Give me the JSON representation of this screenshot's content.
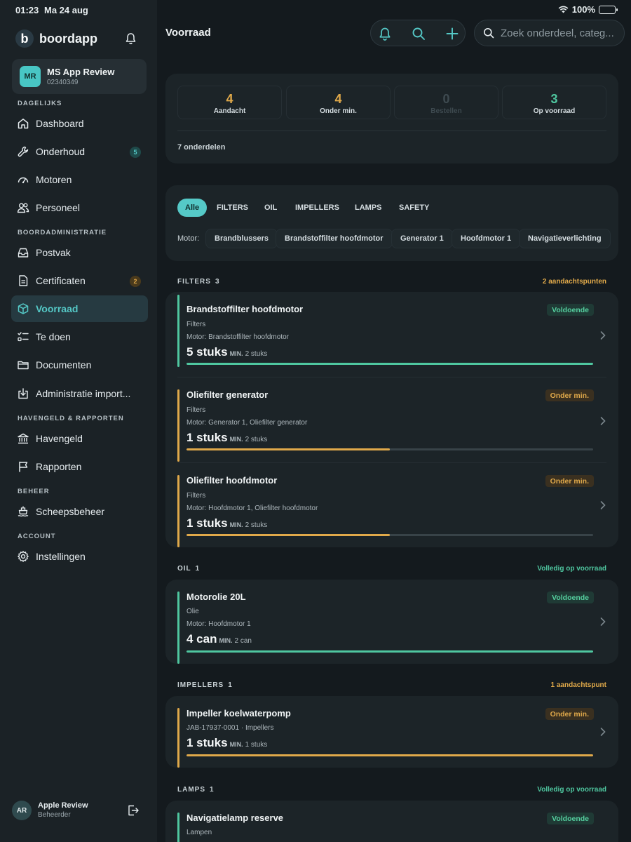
{
  "status_bar": {
    "time": "01:23",
    "date": "Ma 24 aug",
    "battery": "100%"
  },
  "sidebar": {
    "brand": "boordapp",
    "brand_logo_letter": "b",
    "account": {
      "initials": "MR",
      "name": "MS App Review",
      "number": "02340349"
    },
    "sections": {
      "daily": "DAGELIJKS",
      "admin": "BOORDADMINISTRATIE",
      "harbor": "HAVENGELD & RAPPORTEN",
      "manage": "BEHEER",
      "account": "ACCOUNT"
    },
    "items": {
      "dashboard": "Dashboard",
      "onderhoud": "Onderhoud",
      "onderhoud_badge": "5",
      "motoren": "Motoren",
      "personeel": "Personeel",
      "postvak": "Postvak",
      "certificaten": "Certificaten",
      "certificaten_badge": "2",
      "voorraad": "Voorraad",
      "te_doen": "Te doen",
      "documenten": "Documenten",
      "administratie": "Administratie import...",
      "havengeld": "Havengeld",
      "rapporten": "Rapporten",
      "scheepsbeheer": "Scheepsbeheer",
      "instellingen": "Instellingen"
    },
    "user": {
      "initials": "AR",
      "name": "Apple Review",
      "role": "Beheerder"
    }
  },
  "header": {
    "title": "Voorraad",
    "search_placeholder": "Zoek onderdeel, categ..."
  },
  "stats": {
    "aandacht": {
      "value": "4",
      "label": "Aandacht"
    },
    "onder_min": {
      "value": "4",
      "label": "Onder min."
    },
    "bestellen": {
      "value": "0",
      "label": "Bestellen"
    },
    "op_voorraad": {
      "value": "3",
      "label": "Op voorraad"
    },
    "count_text": "7 onderdelen"
  },
  "filters": {
    "categories": [
      "Alle",
      "FILTERS",
      "OIL",
      "IMPELLERS",
      "LAMPS",
      "SAFETY"
    ],
    "motor_label": "Motor:",
    "motors": [
      "Brandblussers",
      "Brandstoffilter hoofdmotor",
      "Generator 1",
      "Hoofdmotor 1",
      "Navigatieverlichting"
    ]
  },
  "sections": [
    {
      "title": "FILTERS",
      "count": "3",
      "note": "2 aandachtspunten",
      "items": [
        {
          "name": "Brandstoffilter hoofdmotor",
          "category": "Filters",
          "motor": "Motor: Brandstoffilter hoofdmotor",
          "qty": "5 stuks",
          "min_label": "MIN.",
          "min": "2 stuks",
          "status": "Voldoende",
          "progress": 1.0
        },
        {
          "name": "Oliefilter generator",
          "category": "Filters",
          "motor": "Motor: Generator 1, Oliefilter generator",
          "qty": "1 stuks",
          "min_label": "MIN.",
          "min": "2 stuks",
          "status": "Onder min.",
          "progress": 0.5
        },
        {
          "name": "Oliefilter hoofdmotor",
          "category": "Filters",
          "motor": "Motor: Hoofdmotor 1, Oliefilter hoofdmotor",
          "qty": "1 stuks",
          "min_label": "MIN.",
          "min": "2 stuks",
          "status": "Onder min.",
          "progress": 0.5
        }
      ]
    },
    {
      "title": "OIL",
      "count": "1",
      "note": "Volledig op voorraad",
      "items": [
        {
          "name": "Motorolie 20L",
          "category": "Olie",
          "motor": "Motor: Hoofdmotor 1",
          "qty": "4 can",
          "min_label": "MIN.",
          "min": "2 can",
          "status": "Voldoende",
          "progress": 1.0
        }
      ]
    },
    {
      "title": "IMPELLERS",
      "count": "1",
      "note": "1 aandachtspunt",
      "items": [
        {
          "name": "Impeller koelwaterpomp",
          "category": "JAB-17937-0001 · Impellers",
          "qty": "1 stuks",
          "min_label": "MIN.",
          "min": "1 stuks",
          "status": "Onder min.",
          "progress": 1.0
        }
      ]
    },
    {
      "title": "LAMPS",
      "count": "1",
      "note": "Volledig op voorraad",
      "items": [
        {
          "name": "Navigatielamp reserve",
          "category": "Lampen",
          "status": "Voldoende"
        }
      ]
    }
  ],
  "colors": {
    "accent": "#55c9c7",
    "ok": "#4fc7a0",
    "warn": "#e0a94a",
    "background": "#141a1e",
    "card": "#1c2428"
  }
}
